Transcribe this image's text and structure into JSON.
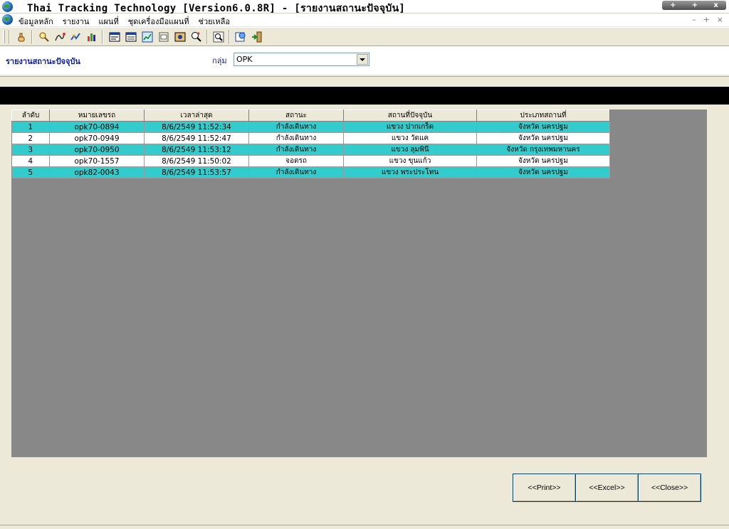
{
  "window": {
    "title": "Thai Tracking Technology [Version6.0.8R] - [รายงานสถานะปัจจุบัน]",
    "controls": [
      "+",
      "+",
      "x"
    ]
  },
  "menu": {
    "items": [
      "ข้อมูลหลัก",
      "รายงาน",
      "แผนที่",
      "ชุดเครื่องมือแผนที่",
      "ช่วยเหลือ"
    ],
    "mdi_controls": [
      "–",
      "+",
      "×"
    ]
  },
  "toolbar": {
    "icons": [
      "hand-icon",
      "vehicle-search-icon",
      "route-icon",
      "track-icon",
      "chart-icon",
      "report-icon",
      "list-icon",
      "graph-icon",
      "window-icon",
      "photo-icon",
      "zoom-map-icon",
      "zoom-in-icon",
      "refresh-icon",
      "exit-icon"
    ]
  },
  "filter": {
    "heading": "รายงานสถานะปัจจุบัน",
    "group_label": "กลุ่ม",
    "group_value": "OPK"
  },
  "table": {
    "columns": [
      "ลำดับ",
      "หมายเลขรถ",
      "เวลาล่าสุด",
      "สถานะ",
      "สถานที่ปัจจุบัน",
      "ประเภทสถานที่"
    ],
    "rows": [
      [
        "1",
        "opk70-0894",
        "8/6/2549 11:52:34",
        "กำลังเดินทาง",
        "แขวง ปากเกร็ด",
        "จังหวัด นครปฐม"
      ],
      [
        "2",
        "opk70-0949",
        "8/6/2549 11:52:47",
        "กำลังเดินทาง",
        "แขวง วัดแค",
        "จังหวัด นครปฐม"
      ],
      [
        "3",
        "opk70-0950",
        "8/6/2549 11:53:12",
        "กำลังเดินทาง",
        "แขวง ลุมพินี",
        "จังหวัด กรุงเทพมหานคร"
      ],
      [
        "4",
        "opk70-1557",
        "8/6/2549 11:50:02",
        "จอดรถ",
        "แขวง ขุนแก้ว",
        "จังหวัด นครปฐม"
      ],
      [
        "5",
        "opk82-0043",
        "8/6/2549 11:53:57",
        "กำลังเดินทาง",
        "แขวง พระประโทน",
        "จังหวัด นครปฐม"
      ]
    ]
  },
  "buttons": {
    "print": "<<Print>>",
    "excel": "<<Excel>>",
    "close": "<<Close>>"
  }
}
